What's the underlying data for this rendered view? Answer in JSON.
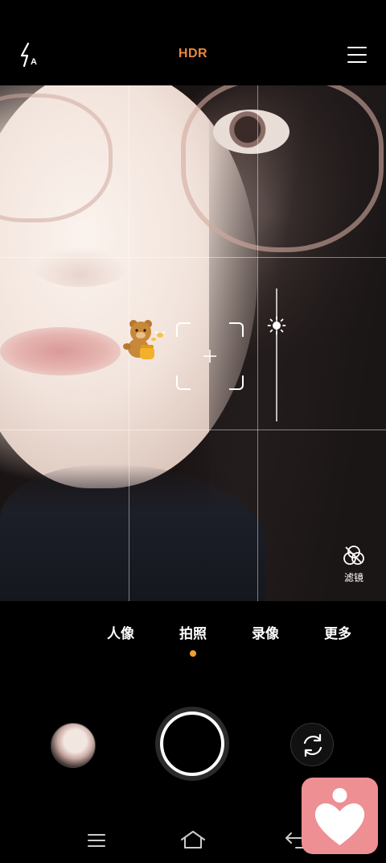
{
  "top_bar": {
    "hdr_label": "HDR",
    "hdr_color": "#e8883a",
    "flash_icon": "flash-auto-icon",
    "menu_icon": "menu-icon"
  },
  "viewfinder": {
    "grid": "3x3",
    "sticker": "bear-with-honey-sticker",
    "exposure_icon": "sun-icon",
    "filter_label": "滤镜"
  },
  "modes": {
    "items": [
      "人像",
      "拍照",
      "录像",
      "更多"
    ],
    "selected": "拍照",
    "indicator_color": "#f0a030"
  },
  "controls": {
    "gallery_icon": "gallery-thumbnail",
    "shutter_icon": "shutter-button",
    "switch_icon": "switch-camera-icon"
  },
  "nav_bar": {
    "icons": [
      "menu-icon",
      "home-icon",
      "back-icon"
    ]
  },
  "overlay_widget": {
    "icon": "heart-person-icon",
    "color": "#ee8f93"
  }
}
